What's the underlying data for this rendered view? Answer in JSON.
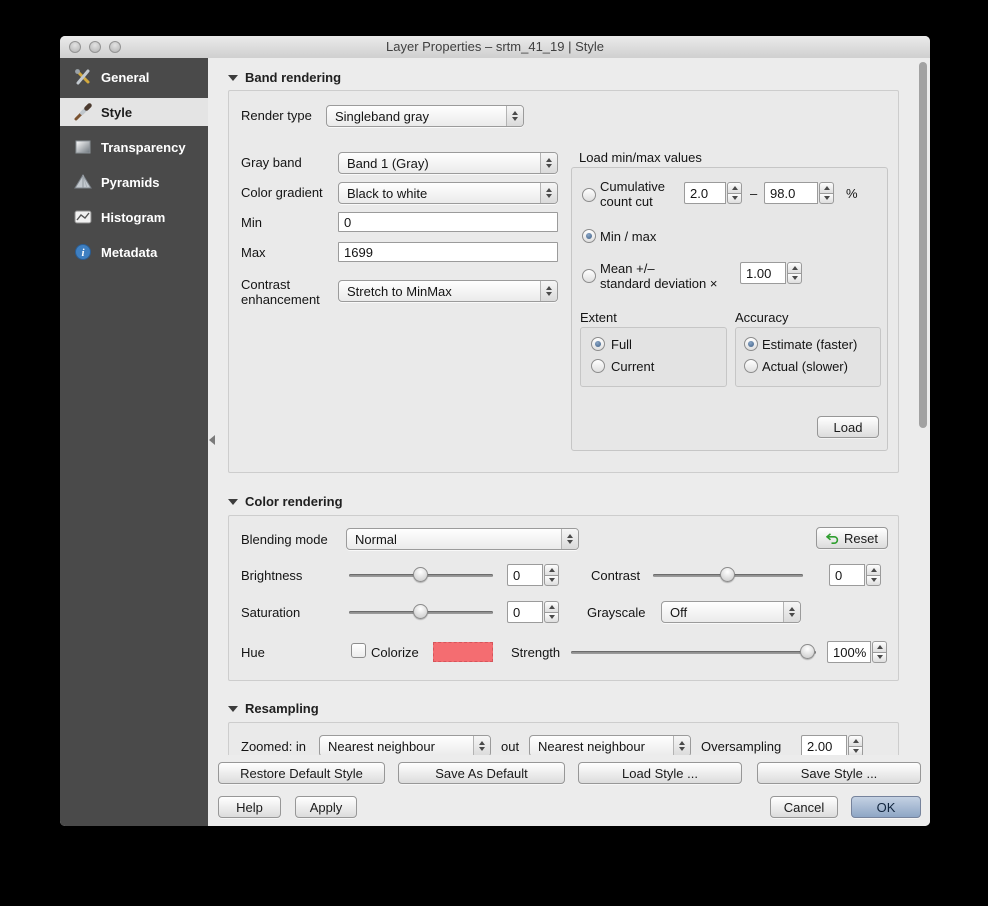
{
  "window": {
    "title": "Layer Properties – srtm_41_19 | Style"
  },
  "sidebar": {
    "items": [
      {
        "label": "General"
      },
      {
        "label": "Style"
      },
      {
        "label": "Transparency"
      },
      {
        "label": "Pyramids"
      },
      {
        "label": "Histogram"
      },
      {
        "label": "Metadata"
      }
    ]
  },
  "band": {
    "header": "Band rendering",
    "render_type": {
      "label": "Render type",
      "value": "Singleband gray"
    },
    "gray_band": {
      "label": "Gray band",
      "value": "Band 1 (Gray)"
    },
    "color_gradient": {
      "label": "Color gradient",
      "value": "Black to white"
    },
    "min": {
      "label": "Min",
      "value": "0"
    },
    "max": {
      "label": "Max",
      "value": "1699"
    },
    "contrast_enh": {
      "label": "Contrast enhancement",
      "value": "Stretch to MinMax"
    },
    "minmax": {
      "title": "Load min/max values",
      "cumulative": {
        "line1": "Cumulative",
        "line2": "count cut",
        "min": "2.0",
        "dash": "–",
        "max": "98.0",
        "unit": "%"
      },
      "minmax_label": "Min / max",
      "mean": {
        "line1": "Mean +/–",
        "line2": "standard deviation ×",
        "value": "1.00"
      },
      "extent": {
        "title": "Extent",
        "full": "Full",
        "current": "Current"
      },
      "accuracy": {
        "title": "Accuracy",
        "estimate": "Estimate (faster)",
        "actual": "Actual (slower)"
      },
      "load": "Load"
    }
  },
  "color": {
    "header": "Color rendering",
    "blending": {
      "label": "Blending mode",
      "value": "Normal"
    },
    "reset": "Reset",
    "brightness": {
      "label": "Brightness",
      "value": "0"
    },
    "contrast": {
      "label": "Contrast",
      "value": "0"
    },
    "saturation": {
      "label": "Saturation",
      "value": "0"
    },
    "grayscale": {
      "label": "Grayscale",
      "value": "Off"
    },
    "hue": {
      "label": "Hue",
      "colorize": "Colorize",
      "strength_label": "Strength",
      "strength_value": "100%"
    }
  },
  "resampling": {
    "header": "Resampling",
    "zoomed_in": {
      "label": "Zoomed: in",
      "value": "Nearest neighbour"
    },
    "zoomed_out": {
      "label": "out",
      "value": "Nearest neighbour"
    },
    "oversampling": {
      "label": "Oversampling",
      "value": "2.00"
    }
  },
  "footer": {
    "restore": "Restore Default Style",
    "save_default": "Save As Default",
    "load_style": "Load Style ...",
    "save_style": "Save Style ...",
    "help": "Help",
    "apply": "Apply",
    "cancel": "Cancel",
    "ok": "OK"
  },
  "colors": {
    "sidebar": "#4a4a4a",
    "hue_swatch": "#f46d71",
    "ok_button": "#8ea6c5",
    "radio_dot": "#3f5f86"
  }
}
